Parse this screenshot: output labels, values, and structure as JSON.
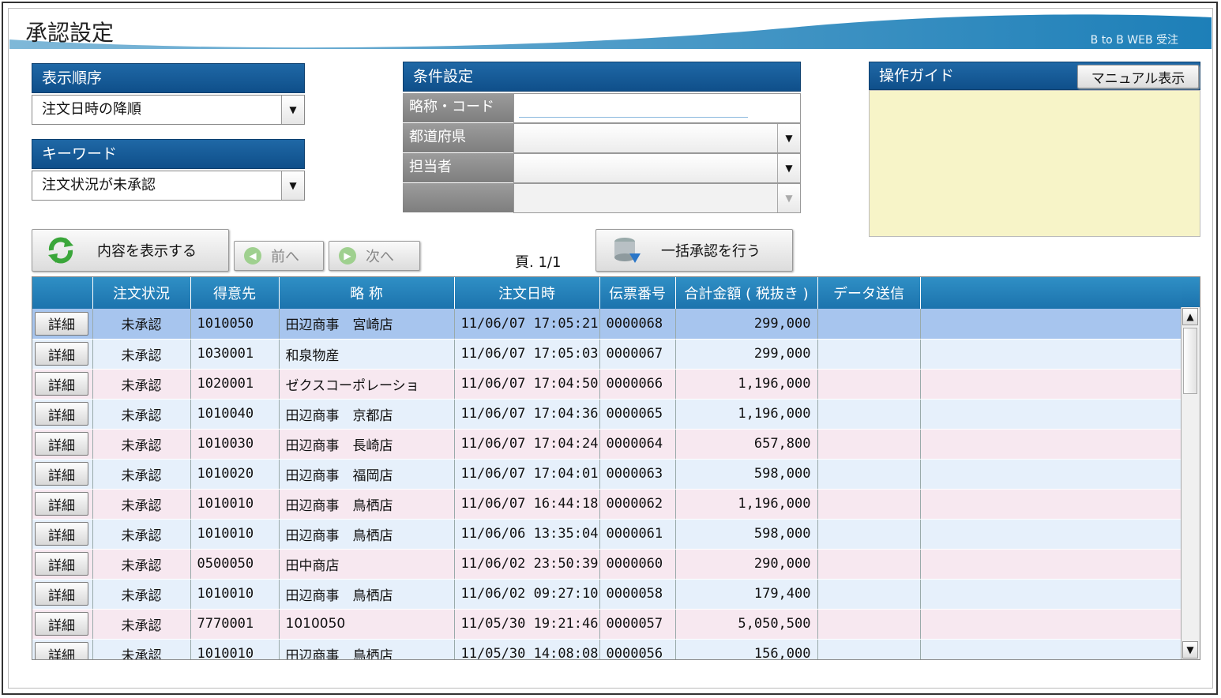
{
  "header": {
    "title": "承認設定",
    "brand": "B to B WEB 受注"
  },
  "display_order": {
    "heading": "表示順序",
    "selected": "注文日時の降順"
  },
  "keyword": {
    "heading": "キーワード",
    "selected": "注文状況が未承認"
  },
  "conditions": {
    "heading": "条件設定",
    "fields": [
      {
        "label": "略称・コード",
        "value": ""
      },
      {
        "label": "都道府県",
        "value": ""
      },
      {
        "label": "担当者",
        "value": ""
      },
      {
        "label": "",
        "value": ""
      }
    ]
  },
  "guide": {
    "heading": "操作ガイド",
    "manual_button": "マニュアル表示"
  },
  "toolbar": {
    "show_button": "内容を表示する",
    "prev_button": "前へ",
    "next_button": "次へ",
    "page": "頁. 1/1",
    "bulk_approve_button": "一括承認を行う"
  },
  "table": {
    "columns": [
      "",
      "注文状況",
      "得意先",
      "略 称",
      "注文日時",
      "伝票番号",
      "合計金額 ( 税抜き )",
      "データ送信",
      ""
    ],
    "detail_label": "詳細",
    "rows": [
      [
        "未承認",
        "1010050",
        "田辺商事　宮崎店",
        "11/06/07 17:05:21",
        "0000068",
        "299,000",
        ""
      ],
      [
        "未承認",
        "1030001",
        "和泉物産",
        "11/06/07 17:05:03",
        "0000067",
        "299,000",
        ""
      ],
      [
        "未承認",
        "1020001",
        "ゼクスコーポレーショ",
        "11/06/07 17:04:50",
        "0000066",
        "1,196,000",
        ""
      ],
      [
        "未承認",
        "1010040",
        "田辺商事　京都店",
        "11/06/07 17:04:36",
        "0000065",
        "1,196,000",
        ""
      ],
      [
        "未承認",
        "1010030",
        "田辺商事　長崎店",
        "11/06/07 17:04:24",
        "0000064",
        "657,800",
        ""
      ],
      [
        "未承認",
        "1010020",
        "田辺商事　福岡店",
        "11/06/07 17:04:01",
        "0000063",
        "598,000",
        ""
      ],
      [
        "未承認",
        "1010010",
        "田辺商事　鳥栖店",
        "11/06/07 16:44:18",
        "0000062",
        "1,196,000",
        ""
      ],
      [
        "未承認",
        "1010010",
        "田辺商事　鳥栖店",
        "11/06/06 13:35:04",
        "0000061",
        "598,000",
        ""
      ],
      [
        "未承認",
        "0500050",
        "田中商店",
        "11/06/02 23:50:39",
        "0000060",
        "290,000",
        ""
      ],
      [
        "未承認",
        "1010010",
        "田辺商事　鳥栖店",
        "11/06/02 09:27:10",
        "0000058",
        "179,400",
        ""
      ],
      [
        "未承認",
        "7770001",
        "1010050",
        "11/05/30 19:21:46",
        "0000057",
        "5,050,500",
        ""
      ],
      [
        "未承認",
        "1010010",
        "田辺商事　鳥栖店",
        "11/05/30 14:08:08",
        "0000056",
        "156,000",
        ""
      ]
    ]
  },
  "colors": {
    "panel_header": "#1f68a6",
    "grid_header": "#2f8fc5",
    "selected_row": "#a7c5ee",
    "guide_bg": "#f7f4c8"
  }
}
